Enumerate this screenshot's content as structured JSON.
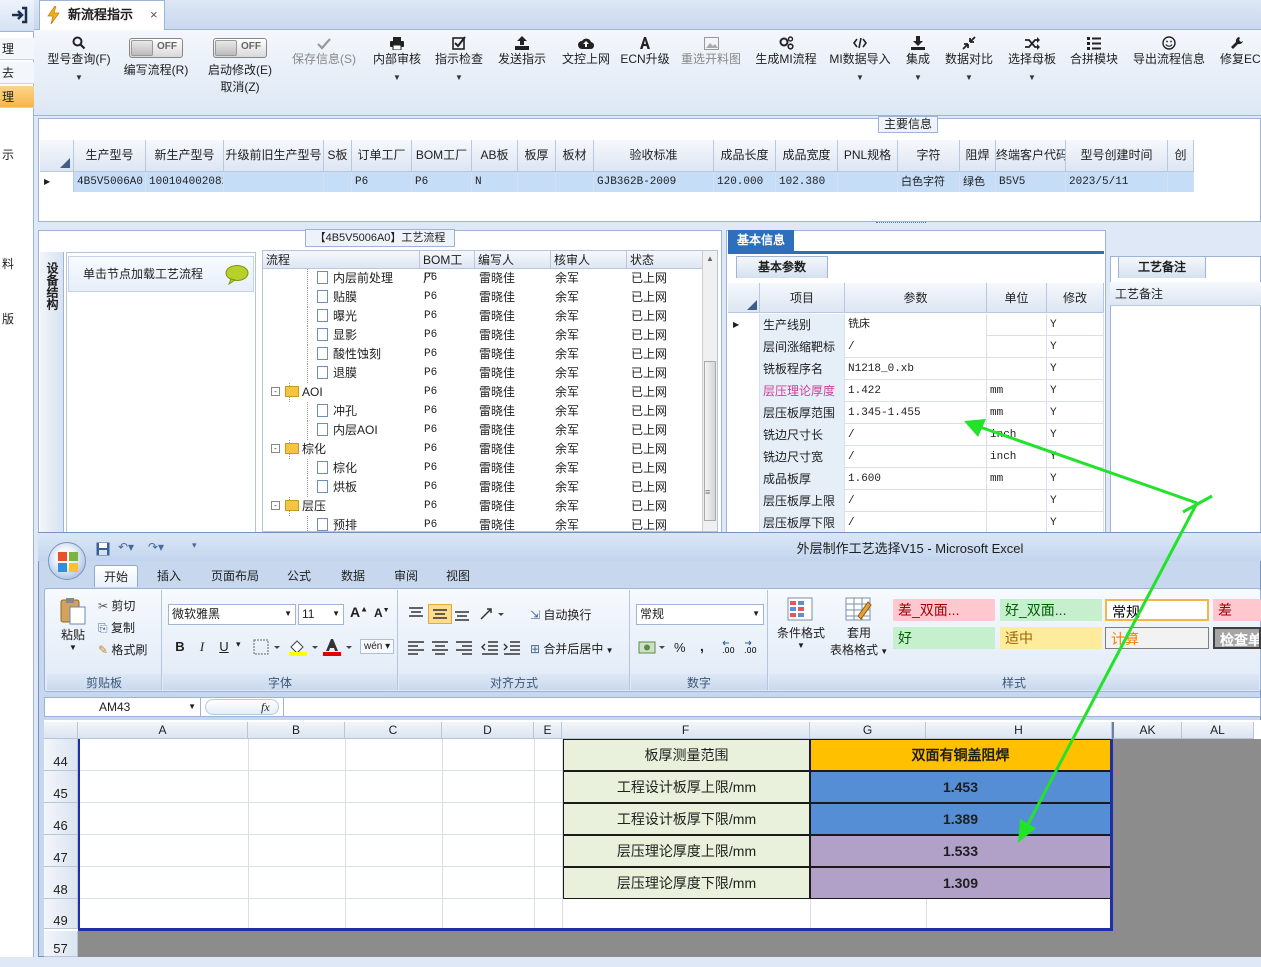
{
  "left_strip": {
    "rows": [
      "理",
      "去",
      "理"
    ],
    "chars": [
      "示",
      "料",
      "版"
    ]
  },
  "tab": {
    "title": "新流程指示",
    "close": "×"
  },
  "toolbar": {
    "items": [
      {
        "label": "型号查询(F)",
        "icon": "search-icon",
        "dropdown": true
      },
      {
        "label": "编写流程(R)",
        "toggle": "OFF"
      },
      {
        "label": "启动修改(E)",
        "label2": "取消(Z)",
        "toggle": "OFF"
      },
      {
        "label": "保存信息(S)",
        "icon": "check-icon",
        "disabled": true
      },
      {
        "label": "内部审核",
        "icon": "printer-icon",
        "dropdown": true
      },
      {
        "label": "指示检查",
        "icon": "checkbox-icon",
        "dropdown": true
      },
      {
        "label": "发送指示",
        "icon": "upload-icon"
      },
      {
        "label": "文控上网",
        "icon": "cloud-upload-icon"
      },
      {
        "label": "ECN升级",
        "icon": "font-icon"
      },
      {
        "label": "重选开料图",
        "icon": "picture-icon",
        "disabled": true
      },
      {
        "label": "生成MI流程",
        "icon": "gears-icon"
      },
      {
        "label": "MI数据导入",
        "icon": "code-icon",
        "dropdown": true
      },
      {
        "label": "集成",
        "icon": "download-icon",
        "dropdown": true
      },
      {
        "label": "数据对比",
        "icon": "compress-icon",
        "dropdown": true
      },
      {
        "label": "选择母板",
        "icon": "random-icon",
        "dropdown": true
      },
      {
        "label": "合拼模块",
        "icon": "list-icon"
      },
      {
        "label": "导出流程信息",
        "icon": "smile-icon"
      },
      {
        "label": "修复ECN",
        "icon": "wrench-icon"
      }
    ]
  },
  "main_info": {
    "label": "主要信息",
    "columns": [
      "生产型号",
      "新生产型号",
      "升级前旧生产型号",
      "S板",
      "订单工厂",
      "BOM工厂",
      "AB板",
      "板厚",
      "板材",
      "验收标准",
      "成品长度",
      "成品宽度",
      "PNL规格",
      "字符",
      "阻焊",
      "终端客户代码",
      "型号创建时间",
      "创"
    ],
    "row": [
      "4B5V5006A0",
      "10010400208214",
      "",
      "",
      "P6",
      "P6",
      "N",
      "",
      "",
      "GJB362B-2009",
      "120.000",
      "102.380",
      "",
      "白色字符",
      "绿色",
      "B5V5",
      "2023/5/11",
      ""
    ]
  },
  "process": {
    "title": "【4B5V5006A0】工艺流程",
    "side_tab": "设备结构",
    "node_button": "单击节点加载工艺流程",
    "columns": [
      "流程",
      "BOM工厂",
      "编写人",
      "核审人",
      "状态"
    ],
    "rows": [
      {
        "name": "内层前处理",
        "level": 2,
        "factory": "P6",
        "writer": "雷晓佳",
        "reviewer": "余军",
        "status": "已上网"
      },
      {
        "name": "贴膜",
        "level": 2,
        "factory": "P6",
        "writer": "雷晓佳",
        "reviewer": "余军",
        "status": "已上网"
      },
      {
        "name": "曝光",
        "level": 2,
        "factory": "P6",
        "writer": "雷晓佳",
        "reviewer": "余军",
        "status": "已上网"
      },
      {
        "name": "显影",
        "level": 2,
        "factory": "P6",
        "writer": "雷晓佳",
        "reviewer": "余军",
        "status": "已上网"
      },
      {
        "name": "酸性蚀刻",
        "level": 2,
        "factory": "P6",
        "writer": "雷晓佳",
        "reviewer": "余军",
        "status": "已上网"
      },
      {
        "name": "退膜",
        "level": 2,
        "factory": "P6",
        "writer": "雷晓佳",
        "reviewer": "余军",
        "status": "已上网"
      },
      {
        "name": "AOI",
        "level": 1,
        "factory": "P6",
        "writer": "雷晓佳",
        "reviewer": "余军",
        "status": "已上网"
      },
      {
        "name": "冲孔",
        "level": 2,
        "factory": "P6",
        "writer": "雷晓佳",
        "reviewer": "余军",
        "status": "已上网"
      },
      {
        "name": "内层AOI",
        "level": 2,
        "factory": "P6",
        "writer": "雷晓佳",
        "reviewer": "余军",
        "status": "已上网"
      },
      {
        "name": "棕化",
        "level": 1,
        "factory": "P6",
        "writer": "雷晓佳",
        "reviewer": "余军",
        "status": "已上网"
      },
      {
        "name": "棕化",
        "level": 2,
        "factory": "P6",
        "writer": "雷晓佳",
        "reviewer": "余军",
        "status": "已上网"
      },
      {
        "name": "烘板",
        "level": 2,
        "factory": "P6",
        "writer": "雷晓佳",
        "reviewer": "余军",
        "status": "已上网"
      },
      {
        "name": "层压",
        "level": 1,
        "factory": "P6",
        "writer": "雷晓佳",
        "reviewer": "余军",
        "status": "已上网"
      },
      {
        "name": "预排",
        "level": 2,
        "factory": "P6",
        "writer": "雷晓佳",
        "reviewer": "余军",
        "status": "已上网"
      }
    ]
  },
  "basic_info": {
    "title": "基本信息",
    "tab": "基本参数",
    "columns": [
      "项目",
      "参数",
      "单位",
      "修改"
    ],
    "rows": [
      {
        "item": "生产线别",
        "param": "铣床",
        "unit": "",
        "edit": "Y",
        "current": true
      },
      {
        "item": "层间涨缩靶标",
        "param": "/",
        "unit": "",
        "edit": "Y"
      },
      {
        "item": "铣板程序名",
        "param": "N1218_0.xb",
        "unit": "",
        "edit": "Y"
      },
      {
        "item": "层压理论厚度",
        "param": "1.422",
        "unit": "mm",
        "edit": "Y",
        "highlight": true
      },
      {
        "item": "层压板厚范围",
        "param": "1.345-1.455",
        "unit": "mm",
        "edit": "Y"
      },
      {
        "item": "铣边尺寸长",
        "param": "/",
        "unit": "inch",
        "edit": "Y"
      },
      {
        "item": "铣边尺寸宽",
        "param": "/",
        "unit": "inch",
        "edit": "Y"
      },
      {
        "item": "成品板厚",
        "param": "1.600",
        "unit": "mm",
        "edit": "Y"
      },
      {
        "item": "层压板厚上限",
        "param": "/",
        "unit": "",
        "edit": "Y"
      },
      {
        "item": "层压板厚下限",
        "param": "/",
        "unit": "",
        "edit": "Y"
      }
    ]
  },
  "remark": {
    "tab": "工艺备注",
    "header": "工艺备注"
  },
  "excel": {
    "title": "外层制作工艺选择V15 - Microsoft Excel",
    "tabs": [
      "开始",
      "插入",
      "页面布局",
      "公式",
      "数据",
      "审阅",
      "视图"
    ],
    "clipboard": {
      "paste": "粘贴",
      "cut": "剪切",
      "copy": "复制",
      "painter": "格式刷",
      "group": "剪贴板"
    },
    "font": {
      "name": "微软雅黑",
      "size": "11",
      "group": "字体",
      "bold": "B",
      "italic": "I",
      "underline": "U",
      "grow": "A",
      "phonetic": "wén"
    },
    "align": {
      "wrap": "自动换行",
      "merge": "合并后居中",
      "group": "对齐方式"
    },
    "number": {
      "format": "常规",
      "group": "数字",
      "percent": "%",
      "comma": ","
    },
    "styles": {
      "cond": "条件格式",
      "table1": "套用",
      "table2": "表格格式",
      "group": "样式",
      "cells": [
        {
          "text": "差_双面...",
          "bg": "#ffc7ce",
          "fg": "#9c0006"
        },
        {
          "text": "好_双面...",
          "bg": "#c6efce",
          "fg": "#006100"
        },
        {
          "text": "常规",
          "bg": "#ffffff",
          "fg": "#000000"
        },
        {
          "text": "差",
          "bg": "#ffc7ce",
          "fg": "#9c0006"
        },
        {
          "text": "好",
          "bg": "#c6efce",
          "fg": "#006100"
        },
        {
          "text": "适中",
          "bg": "#ffeb9c",
          "fg": "#9c6500"
        },
        {
          "text": "计算",
          "bg": "#f2f2f2",
          "fg": "#fa7d00"
        },
        {
          "text": "检查单",
          "bg": "#a5a5a5",
          "fg": "#ffffff"
        }
      ]
    },
    "name_box": "AM43",
    "fx": "fx",
    "columns": [
      "A",
      "B",
      "C",
      "D",
      "E",
      "F",
      "G",
      "H",
      "AK",
      "AL"
    ],
    "rows": [
      "44",
      "45",
      "46",
      "47",
      "48",
      "49",
      "57"
    ],
    "table": {
      "header_label": "板厚测量范围",
      "header_value": "双面有铜盖阻焊",
      "rows": [
        {
          "label": "工程设计板厚上限/mm",
          "value": "1.453",
          "color": "#558ed5"
        },
        {
          "label": "工程设计板厚下限/mm",
          "value": "1.389",
          "color": "#558ed5"
        },
        {
          "label": "层压理论厚度上限/mm",
          "value": "1.533",
          "color": "#b1a0c7"
        },
        {
          "label": "层压理论厚度下限/mm",
          "value": "1.309",
          "color": "#b1a0c7"
        }
      ],
      "header_color": "#ffc000"
    }
  }
}
